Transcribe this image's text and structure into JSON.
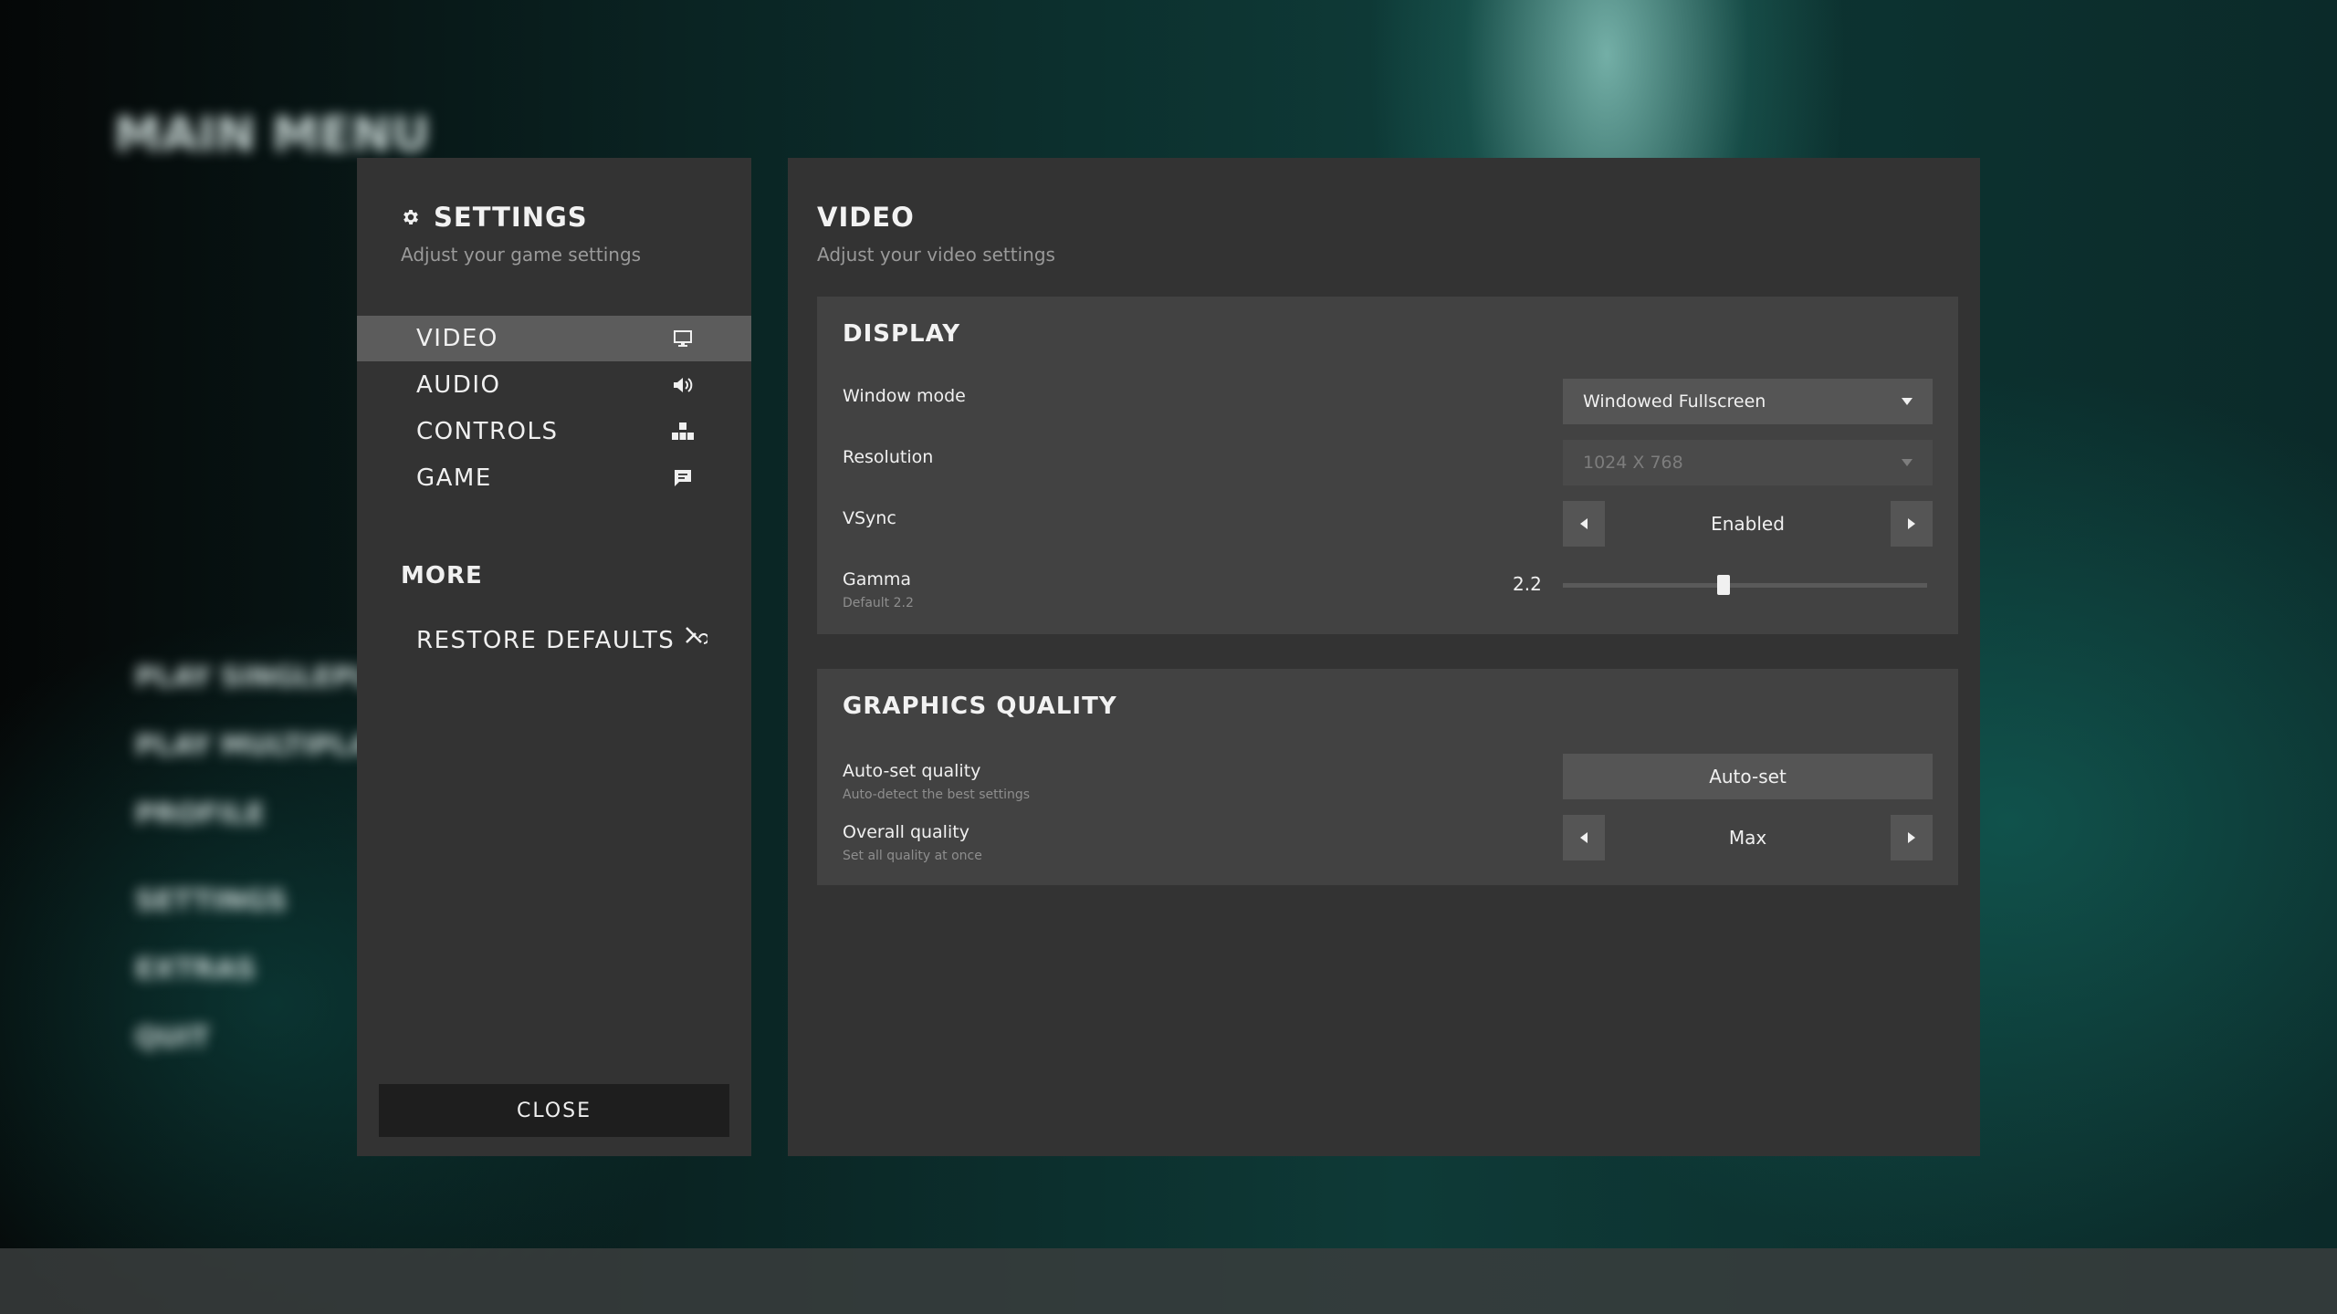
{
  "background": {
    "heading": "MAIN MENU",
    "menu_items": [
      "PLAY SINGLEPLAYER",
      "PLAY MULTIPLAYER",
      "PROFILE",
      "SETTINGS",
      "EXTRAS",
      "QUIT"
    ]
  },
  "settings_panel": {
    "title": "SETTINGS",
    "subtitle": "Adjust your game settings",
    "nav": [
      {
        "label": "VIDEO",
        "icon": "monitor-icon",
        "active": true
      },
      {
        "label": "AUDIO",
        "icon": "speaker-icon",
        "active": false
      },
      {
        "label": "CONTROLS",
        "icon": "controls-icon",
        "active": false
      },
      {
        "label": "GAME",
        "icon": "chat-icon",
        "active": false
      }
    ],
    "more_title": "MORE",
    "restore_label": "RESTORE DEFAULTS",
    "close_label": "CLOSE"
  },
  "video_panel": {
    "title": "VIDEO",
    "subtitle": "Adjust your video settings",
    "display": {
      "title": "DISPLAY",
      "window_mode": {
        "label": "Window mode",
        "value": "Windowed Fullscreen"
      },
      "resolution": {
        "label": "Resolution",
        "value": "1024 X 768",
        "disabled": true
      },
      "vsync": {
        "label": "VSync",
        "value": "Enabled"
      },
      "gamma": {
        "label": "Gamma",
        "sub": "Default 2.2",
        "value": "2.2",
        "fraction": 0.44
      }
    },
    "graphics": {
      "title": "GRAPHICS QUALITY",
      "auto_set": {
        "label": "Auto-set quality",
        "sub": "Auto-detect the best settings",
        "button": "Auto-set"
      },
      "overall": {
        "label": "Overall quality",
        "sub": "Set all quality at once",
        "value": "Max"
      }
    }
  },
  "colors": {
    "panel": "#333333",
    "card": "#424242",
    "control": "#555555",
    "active_nav": "#5c5c5c",
    "close_button": "#1e1e1e",
    "accent_teal": "#0e3a37"
  }
}
